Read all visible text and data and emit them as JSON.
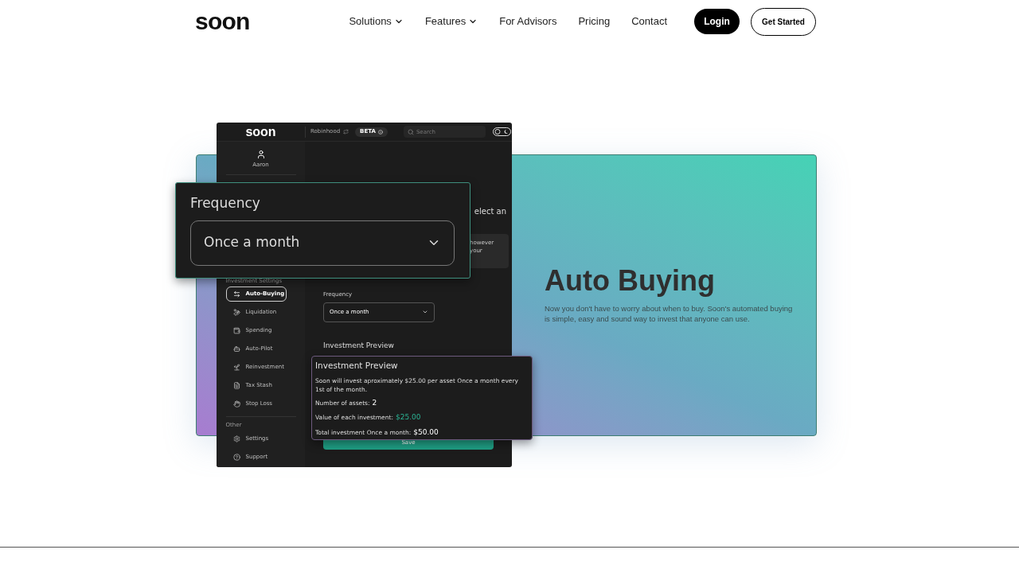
{
  "nav": {
    "logo": "soon",
    "links": [
      {
        "label": "Solutions",
        "dropdown": true
      },
      {
        "label": "Features",
        "dropdown": true
      },
      {
        "label": "For Advisors",
        "dropdown": false
      },
      {
        "label": "Pricing",
        "dropdown": false
      },
      {
        "label": "Contact",
        "dropdown": false
      }
    ],
    "login": "Login",
    "get_started": "Get Started"
  },
  "app": {
    "logo": "soon",
    "broker": "Robinhood",
    "badge": "BETA",
    "search": {
      "placeholder": "Search"
    },
    "user": "Aaron",
    "sidebar": [
      {
        "heading": "Investment Settings",
        "items": [
          {
            "label": "Auto-Buying",
            "selected": true
          },
          {
            "label": "Liquidation",
            "selected": false
          },
          {
            "label": "Spending",
            "selected": false
          },
          {
            "label": "Auto-Pilot",
            "selected": false
          },
          {
            "label": "Reinvestment",
            "selected": false
          },
          {
            "label": "Tax Stash",
            "selected": false
          },
          {
            "label": "Stop Loss",
            "selected": false
          }
        ]
      },
      {
        "heading": "Other",
        "items": [
          {
            "label": "Settings",
            "selected": false
          },
          {
            "label": "Support",
            "selected": false
          }
        ]
      }
    ],
    "intro_fragment": "elect an",
    "notice_lines": [
      "however",
      "your"
    ],
    "frequency_label": "Frequency",
    "frequency_value": "Once a month",
    "preview_title": "Investment Preview",
    "save": "Save"
  },
  "frequency_popup": {
    "label": "Frequency",
    "value": "Once a month"
  },
  "preview_popup": {
    "title": "Investment Preview",
    "sentence": "Soon will invest aproximately $25.00 per asset Once a month every 1st of the month.",
    "rows": [
      {
        "label": "Number of assets:",
        "value": "2",
        "highlight": false
      },
      {
        "label": "Value of each investment:",
        "value": "$25.00",
        "highlight": true
      },
      {
        "label": "Total investment Once a month:",
        "value": "$50.00",
        "highlight": false
      }
    ]
  },
  "hero": {
    "title": "Auto Buying",
    "description": "Now you don't have to worry about when to buy. Soon's automated buying is simple, easy and sound way to invest that anyone can use."
  }
}
